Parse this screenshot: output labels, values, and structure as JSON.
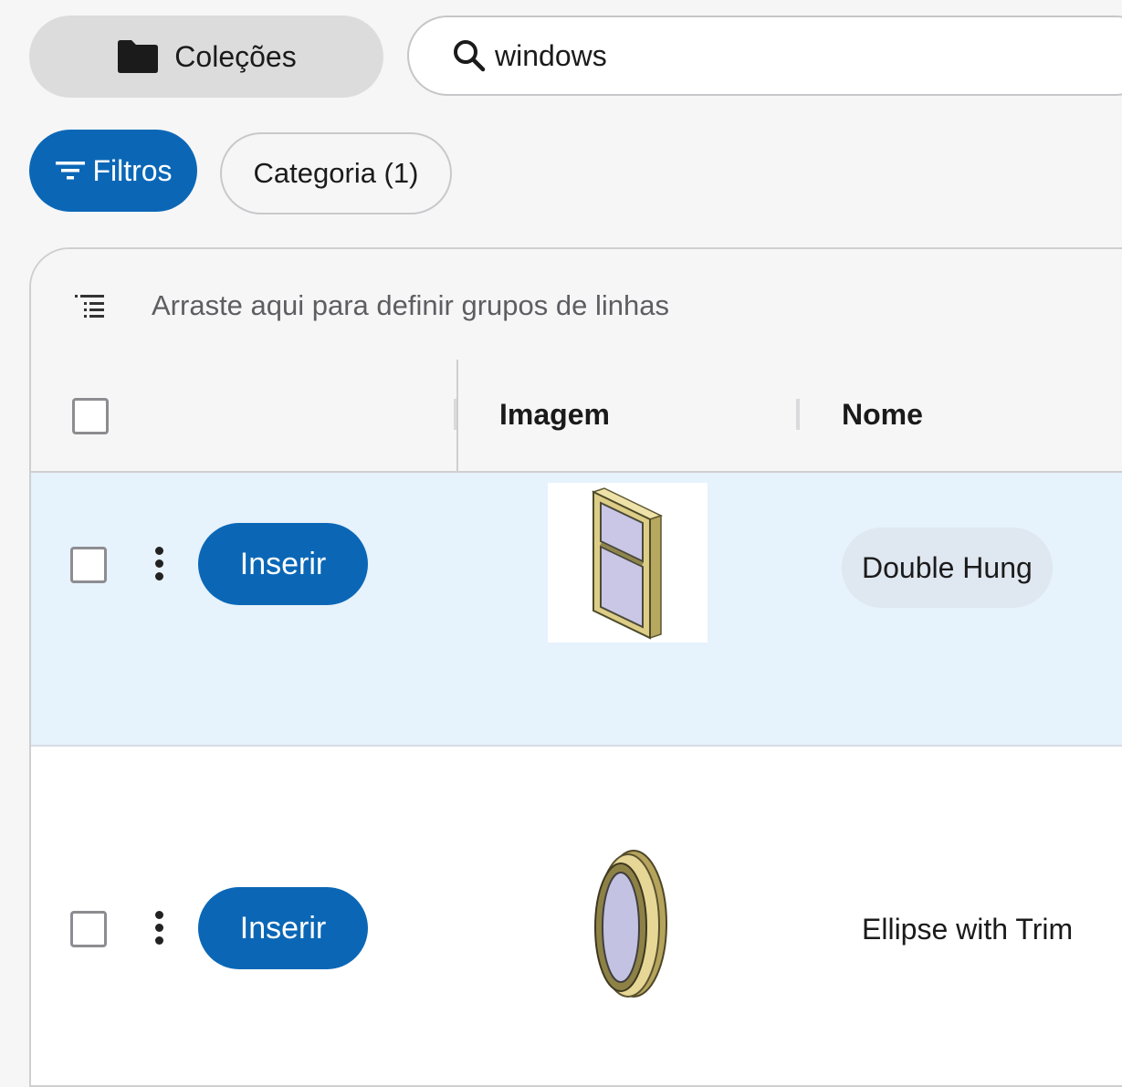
{
  "toolbar": {
    "collections_label": "Coleções",
    "search_value": "windows"
  },
  "filters": {
    "filters_label": "Filtros",
    "category_label": "Categoria (1)"
  },
  "grid": {
    "group_hint": "Arraste aqui para definir grupos de linhas",
    "columns": [
      "Imagem",
      "Nome"
    ],
    "rows": [
      {
        "insert_label": "Inserir",
        "name": "Double Hung",
        "image": "double-hung-window-thumbnail",
        "selected": true
      },
      {
        "insert_label": "Inserir",
        "name": "Ellipse with Trim",
        "image": "ellipse-window-thumbnail",
        "selected": false
      }
    ]
  },
  "colors": {
    "accent": "#0b67b6",
    "row_highlight": "#e6f2fc",
    "name_chip": "#dfe7f0"
  }
}
